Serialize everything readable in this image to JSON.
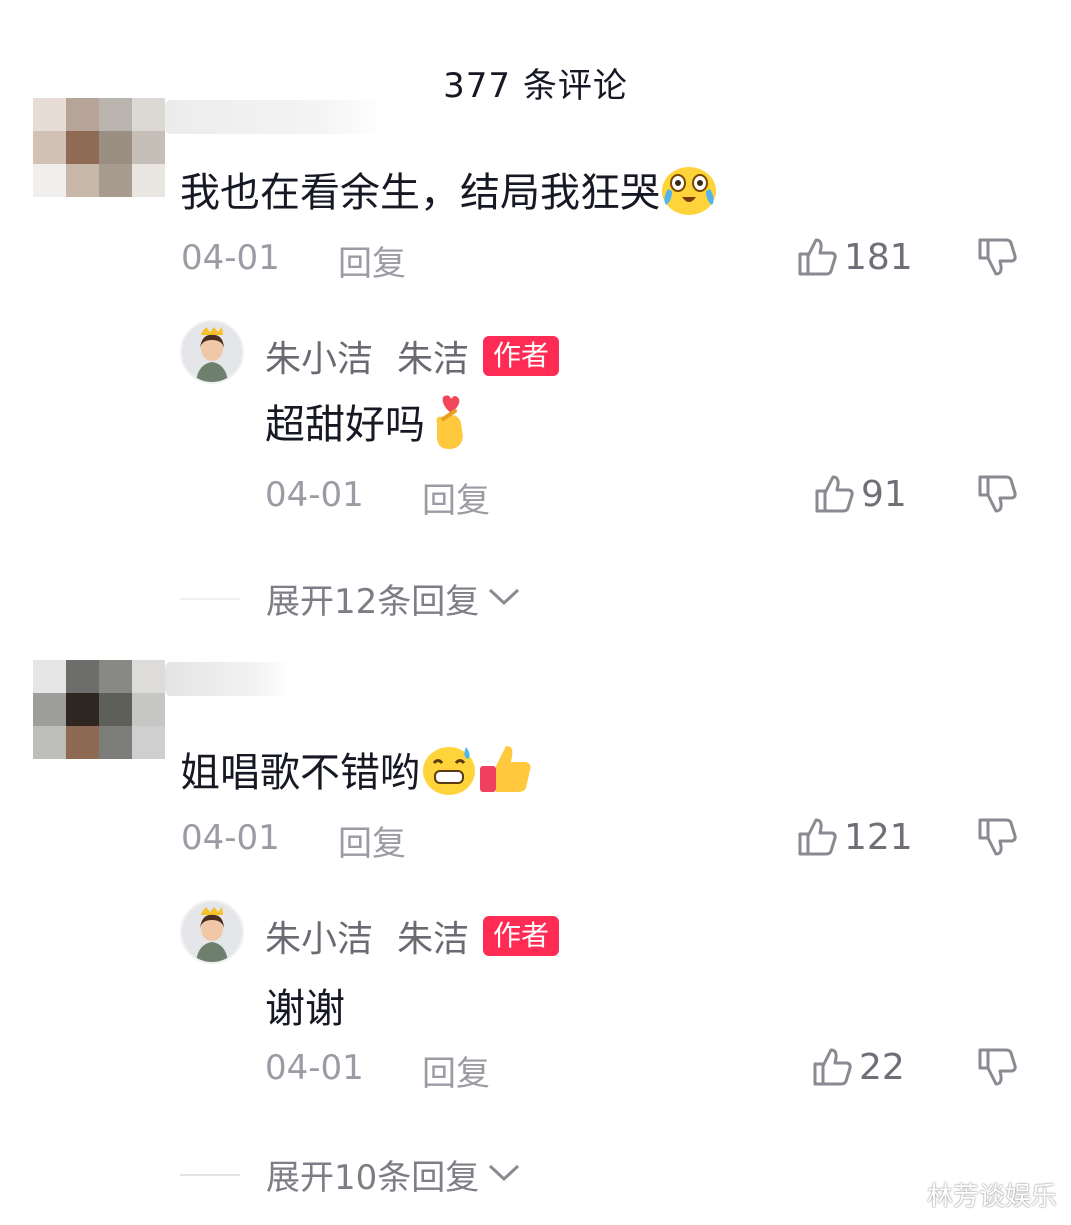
{
  "header": {
    "title": "377 条评论"
  },
  "comments": [
    {
      "text": "我也在看余生，结局我狂哭",
      "emoji": "crying-laughing-emoji",
      "date": "04-01",
      "reply_label": "回复",
      "likes": "181",
      "reply": {
        "name": "朱小洁",
        "name2": "朱洁",
        "badge": "作者",
        "text": "超甜好吗",
        "emoji": "finger-heart-emoji",
        "date": "04-01",
        "reply_label": "回复",
        "likes": "91"
      },
      "expand_label": "展开12条回复"
    },
    {
      "text": "姐唱歌不错哟",
      "emoji": "grinning-sweat-emoji, thumbs-up-emoji",
      "date": "04-01",
      "reply_label": "回复",
      "likes": "121",
      "reply": {
        "name": "朱小洁",
        "name2": "朱洁",
        "badge": "作者",
        "text": "谢谢",
        "date": "04-01",
        "reply_label": "回复",
        "likes": "22"
      },
      "expand_label": "展开10条回复"
    }
  ],
  "watermark": "林芳谈娱乐",
  "colors": {
    "badge": "#fe2c55",
    "meta": "#9b9ba3",
    "text": "#161823"
  }
}
